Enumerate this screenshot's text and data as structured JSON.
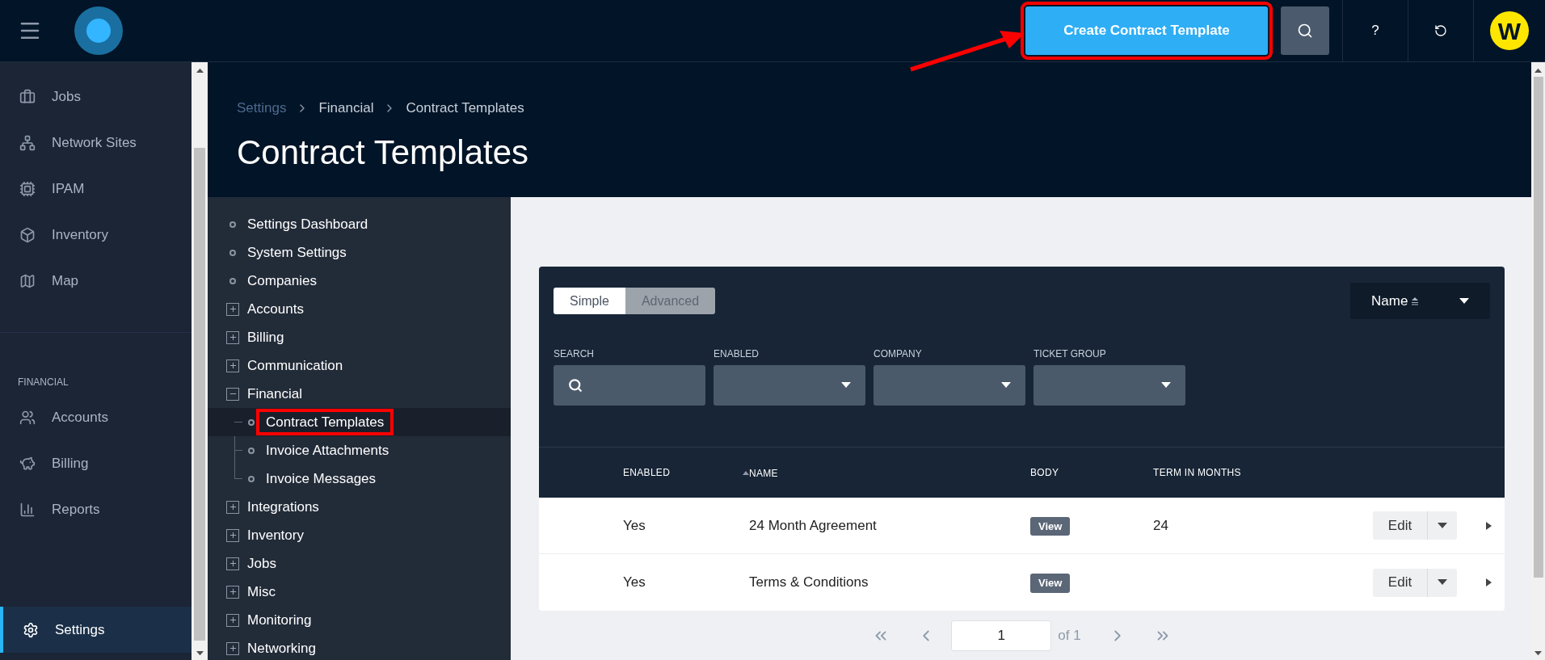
{
  "topbar": {
    "create_button": {
      "label": "Create Contract Template",
      "highlighted": true
    },
    "help": "?",
    "avatar": "W"
  },
  "sidebar": {
    "items": [
      {
        "label": "Jobs",
        "selected": false
      },
      {
        "label": "Network Sites",
        "selected": false
      },
      {
        "label": "IPAM",
        "selected": false
      },
      {
        "label": "Inventory",
        "selected": false
      },
      {
        "label": "Map",
        "selected": false
      }
    ],
    "section": "FINANCIAL",
    "financial_items": [
      {
        "label": "Accounts",
        "selected": false
      },
      {
        "label": "Billing",
        "selected": false
      },
      {
        "label": "Reports",
        "selected": false
      }
    ],
    "bottom_items": [
      {
        "label": "Settings",
        "selected": true
      }
    ]
  },
  "breadcrumb": [
    "Settings",
    "Financial",
    "Contract Templates"
  ],
  "page_title": "Contract Templates",
  "tree": [
    {
      "label": "Settings Dashboard",
      "kind": "leaf",
      "selected": false,
      "highlighted": false
    },
    {
      "label": "System Settings",
      "kind": "leaf",
      "selected": false,
      "highlighted": false
    },
    {
      "label": "Companies",
      "kind": "leaf",
      "selected": false,
      "highlighted": false
    },
    {
      "label": "Accounts",
      "kind": "group",
      "expanded": false
    },
    {
      "label": "Billing",
      "kind": "group",
      "expanded": false
    },
    {
      "label": "Communication",
      "kind": "group",
      "expanded": false
    },
    {
      "label": "Financial",
      "kind": "group",
      "expanded": true,
      "children": [
        {
          "label": "Contract Templates",
          "kind": "leaf",
          "selected": true,
          "highlighted": true
        },
        {
          "label": "Invoice Attachments",
          "kind": "leaf",
          "selected": false,
          "highlighted": false
        },
        {
          "label": "Invoice Messages",
          "kind": "leaf",
          "selected": false,
          "highlighted": false
        }
      ]
    },
    {
      "label": "Integrations",
      "kind": "group",
      "expanded": false
    },
    {
      "label": "Inventory",
      "kind": "group",
      "expanded": false
    },
    {
      "label": "Jobs",
      "kind": "group",
      "expanded": false
    },
    {
      "label": "Misc",
      "kind": "group",
      "expanded": false
    },
    {
      "label": "Monitoring",
      "kind": "group",
      "expanded": false
    },
    {
      "label": "Networking",
      "kind": "group",
      "expanded": false
    }
  ],
  "filter_modes": [
    {
      "label": "Simple",
      "selected": true
    },
    {
      "label": "Advanced",
      "selected": false
    }
  ],
  "sort": {
    "label": "Name"
  },
  "filters": [
    {
      "label": "SEARCH",
      "kind": "search"
    },
    {
      "label": "ENABLED",
      "kind": "select"
    },
    {
      "label": "COMPANY",
      "kind": "select"
    },
    {
      "label": "TICKET GROUP",
      "kind": "select"
    }
  ],
  "table": {
    "columns": [
      {
        "label": "ENABLED",
        "sorted": false
      },
      {
        "label": "NAME",
        "sorted": true
      },
      {
        "label": "BODY",
        "sorted": false
      },
      {
        "label": "TERM IN MONTHS",
        "sorted": false
      }
    ],
    "rows": [
      {
        "enabled": "Yes",
        "name": "24 Month Agreement",
        "body": "View",
        "term": "24",
        "action": "Edit"
      },
      {
        "enabled": "Yes",
        "name": "Terms & Conditions",
        "body": "View",
        "action": "Edit"
      }
    ]
  },
  "pagination": {
    "page": "1",
    "of": "of 1"
  }
}
